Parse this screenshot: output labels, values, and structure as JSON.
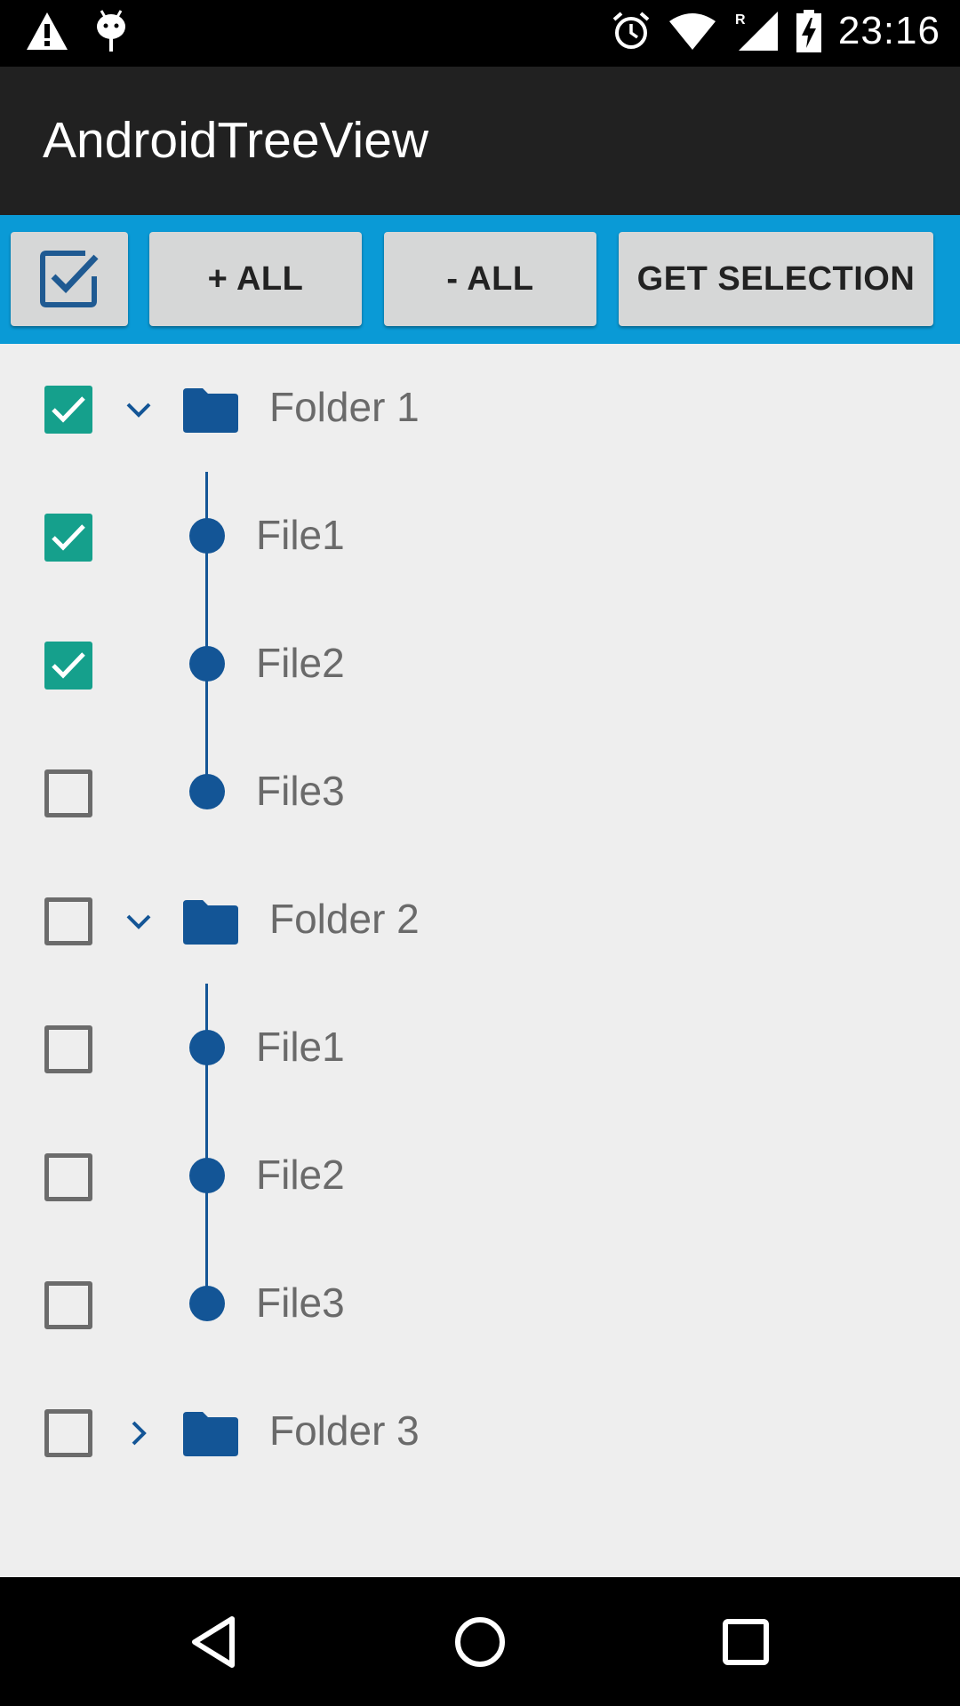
{
  "status_bar": {
    "time": "23:16",
    "left_icons": [
      "warning-icon",
      "android-debug-icon"
    ],
    "right_icons": [
      "alarm-icon",
      "wifi-icon",
      "signal-roaming-icon",
      "battery-charging-icon"
    ]
  },
  "action_bar": {
    "title": "AndroidTreeView"
  },
  "toolbar": {
    "select_mode_icon": "checkbox-icon",
    "expand_all_label": "+ ALL",
    "collapse_all_label": "- ALL",
    "get_selection_label": "GET SELECTION"
  },
  "tree": {
    "folders": [
      {
        "label": "Folder 1",
        "checked": true,
        "expanded": true,
        "files": [
          {
            "label": "File1",
            "checked": true
          },
          {
            "label": "File2",
            "checked": true
          },
          {
            "label": "File3",
            "checked": false
          }
        ]
      },
      {
        "label": "Folder 2",
        "checked": false,
        "expanded": true,
        "files": [
          {
            "label": "File1",
            "checked": false
          },
          {
            "label": "File2",
            "checked": false
          },
          {
            "label": "File3",
            "checked": false
          }
        ]
      },
      {
        "label": "Folder 3",
        "checked": false,
        "expanded": false,
        "files": []
      }
    ]
  },
  "colors": {
    "status_bar": "#000000",
    "action_bar": "#212121",
    "toolbar": "#0a9ad6",
    "checkbox_checked": "#15a08c",
    "tree_accent": "#135596",
    "background": "#eeeeee"
  },
  "nav_bar": {
    "icons": [
      "back-icon",
      "home-icon",
      "recents-icon"
    ]
  }
}
